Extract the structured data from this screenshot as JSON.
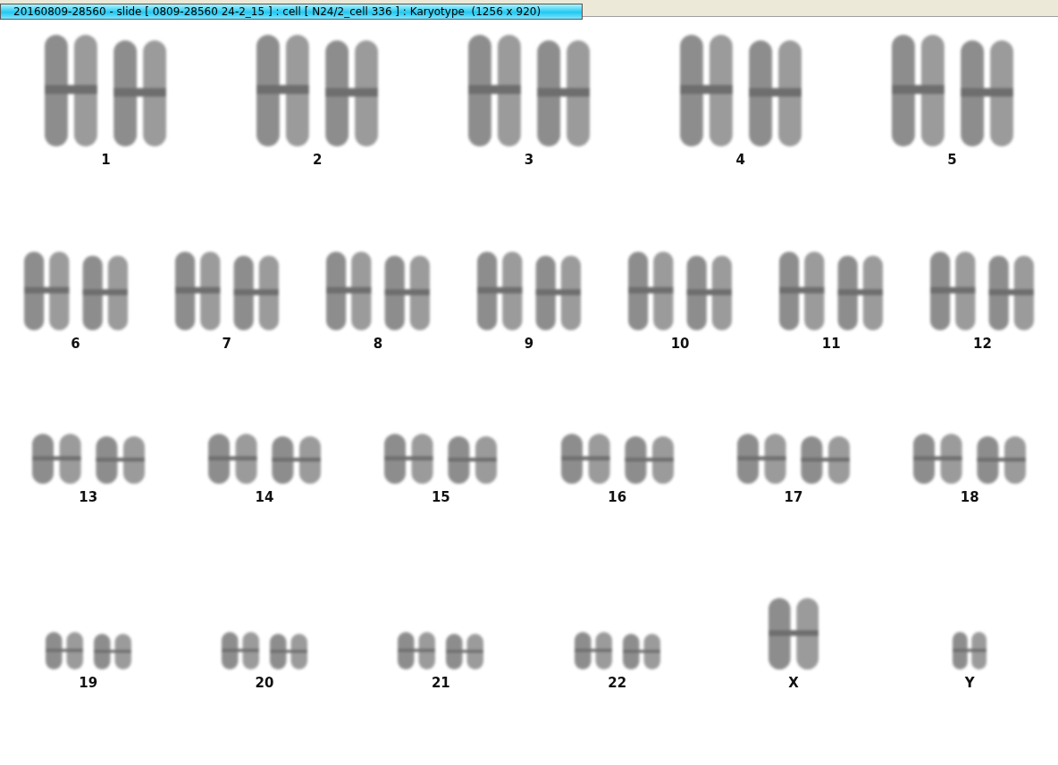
{
  "window": {
    "title": "20160809-28560 - slide [ 0809-28560 24-2_15 ] : cell [ N24/2_cell 336 ] : Karyotype  (1256 x 920)"
  },
  "karyotype": {
    "rows": [
      {
        "items": [
          {
            "label": "1",
            "kind": "pair"
          },
          {
            "label": "2",
            "kind": "pair"
          },
          {
            "label": "3",
            "kind": "pair"
          },
          {
            "label": "4",
            "kind": "pair"
          },
          {
            "label": "5",
            "kind": "pair"
          }
        ]
      },
      {
        "items": [
          {
            "label": "6",
            "kind": "pair"
          },
          {
            "label": "7",
            "kind": "pair"
          },
          {
            "label": "8",
            "kind": "pair"
          },
          {
            "label": "9",
            "kind": "pair"
          },
          {
            "label": "10",
            "kind": "pair"
          },
          {
            "label": "11",
            "kind": "pair"
          },
          {
            "label": "12",
            "kind": "pair"
          }
        ]
      },
      {
        "items": [
          {
            "label": "13",
            "kind": "pair"
          },
          {
            "label": "14",
            "kind": "pair"
          },
          {
            "label": "15",
            "kind": "pair"
          },
          {
            "label": "16",
            "kind": "pair"
          },
          {
            "label": "17",
            "kind": "pair"
          },
          {
            "label": "18",
            "kind": "pair"
          }
        ]
      },
      {
        "items": [
          {
            "label": "19",
            "kind": "pair"
          },
          {
            "label": "20",
            "kind": "pair"
          },
          {
            "label": "21",
            "kind": "pair"
          },
          {
            "label": "22",
            "kind": "pair"
          },
          {
            "label": "X",
            "kind": "single"
          },
          {
            "label": "Y",
            "kind": "single"
          }
        ]
      }
    ]
  }
}
